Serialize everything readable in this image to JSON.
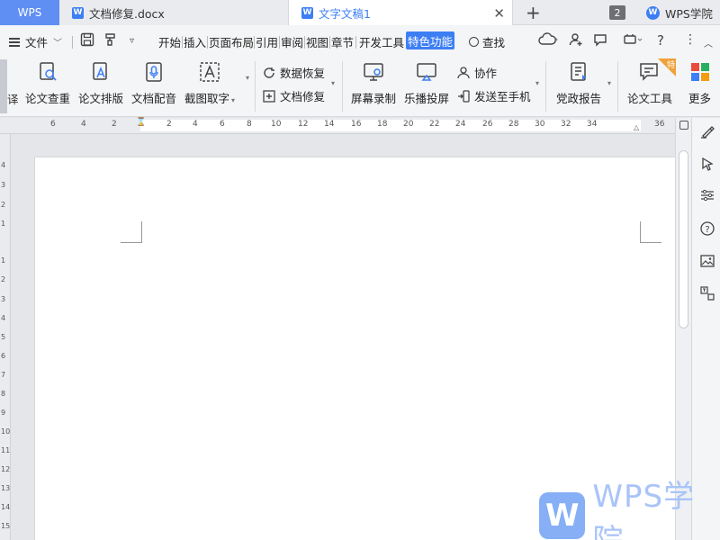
{
  "titlebar": {
    "app_tab": "WPS",
    "doc_tabs": [
      {
        "label": "文档修复.docx",
        "active": false
      },
      {
        "label": "文字文稿1",
        "active": true
      }
    ],
    "window_count": "2",
    "academy_label": "WPS学院"
  },
  "menu": {
    "file_label": "文件",
    "tabs": [
      "开始",
      "插入",
      "页面布局",
      "引用",
      "审阅",
      "视图",
      "章节",
      "开发工具",
      "特色功能"
    ],
    "active_tab": "特色功能",
    "search_label": "查找"
  },
  "ribbon": {
    "partial_left_label": "译",
    "big_buttons": [
      {
        "label": "论文查重",
        "icon": "paper-check-icon"
      },
      {
        "label": "论文排版",
        "icon": "paper-layout-icon"
      },
      {
        "label": "文档配音",
        "icon": "microphone-icon"
      },
      {
        "label": "截图取字",
        "icon": "ocr-icon"
      }
    ],
    "small_buttons_group1": [
      {
        "label": "数据恢复",
        "icon": "data-recovery-icon"
      },
      {
        "label": "文档修复",
        "icon": "doc-repair-icon"
      }
    ],
    "big_buttons2": [
      {
        "label": "屏幕录制",
        "icon": "screen-record-icon"
      },
      {
        "label": "乐播投屏",
        "icon": "cast-screen-icon"
      }
    ],
    "small_buttons_group2": [
      {
        "label": "协作",
        "icon": "collaborate-icon"
      },
      {
        "label": "发送至手机",
        "icon": "send-phone-icon"
      }
    ],
    "big_buttons3": [
      {
        "label": "党政报告",
        "icon": "report-icon"
      },
      {
        "label": "论文工具",
        "icon": "paper-tool-icon",
        "badge": "特"
      },
      {
        "label": "更多",
        "icon": "more-apps-icon"
      }
    ]
  },
  "ruler": {
    "h_labels": [
      "6",
      "4",
      "2",
      "2",
      "4",
      "6",
      "8",
      "10",
      "12",
      "14",
      "16",
      "18",
      "20",
      "22",
      "24",
      "26",
      "28",
      "30",
      "32",
      "34",
      "36"
    ],
    "v_labels": [
      "4",
      "3",
      "2",
      "1",
      "1",
      "2",
      "3",
      "4",
      "5",
      "6",
      "7",
      "8",
      "9",
      "10",
      "11",
      "12",
      "13",
      "14",
      "15"
    ]
  },
  "watermark": {
    "logo_letter": "W",
    "text": "WPS学院"
  },
  "colors": {
    "accent": "#3d7ef4",
    "tab_wps_bg": "#5f8ff2",
    "chrome_bg": "#f4f5f7"
  }
}
